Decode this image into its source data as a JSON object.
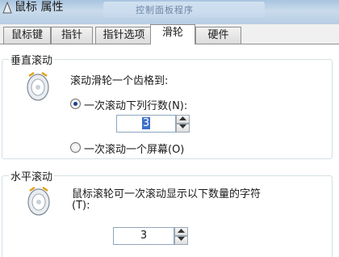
{
  "window": {
    "title": "鼠标 属性",
    "background_caption": "控制面板程序"
  },
  "tabs": [
    {
      "label": "鼠标键",
      "active": false
    },
    {
      "label": "指针",
      "active": false
    },
    {
      "label": "指针选项",
      "active": false
    },
    {
      "label": "滑轮",
      "active": true
    },
    {
      "label": "硬件",
      "active": false
    }
  ],
  "vertical_scroll": {
    "group_title": "垂直滚动",
    "description": "滚动滑轮一个齿格到:",
    "option_lines": {
      "label": "一次滚动下列行数(N):",
      "selected": true
    },
    "lines_value": "3",
    "option_screen": {
      "label": "一次滚动一个屏幕(O)",
      "selected": false
    }
  },
  "horizontal_scroll": {
    "group_title": "水平滚动",
    "description_line1": "鼠标滚轮可一次滚动显示以下数量的字符",
    "description_line2": "(T):",
    "chars_value": "3"
  },
  "icons": {
    "app": "mouse-icon",
    "wheel": "mouse-wheel-icon",
    "spin_up": "arrow-up-icon",
    "spin_down": "arrow-down-icon"
  },
  "colors": {
    "titlebar": "#b7cde4",
    "selection": "#3b6fcb",
    "radio_dot": "#1c3f8f"
  }
}
